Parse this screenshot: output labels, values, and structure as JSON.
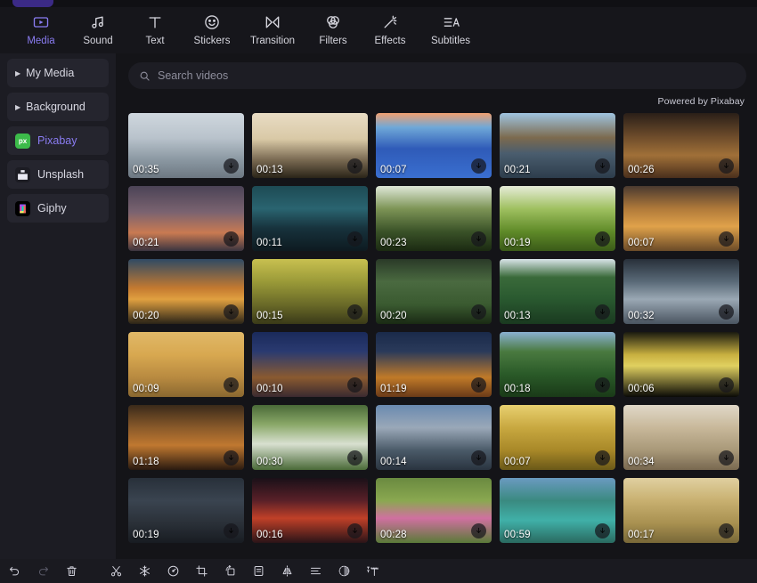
{
  "app": {
    "accent": "#8a7cf2",
    "panel_bg": "#141418",
    "sidebar_bg": "#1c1c23"
  },
  "topbar": {
    "tabs": [
      {
        "label": "Media",
        "icon": "media-play-icon",
        "active": true
      },
      {
        "label": "Sound",
        "icon": "music-note-icon",
        "active": false
      },
      {
        "label": "Text",
        "icon": "text-t-icon",
        "active": false
      },
      {
        "label": "Stickers",
        "icon": "smiley-icon",
        "active": false
      },
      {
        "label": "Transition",
        "icon": "transition-icon",
        "active": false
      },
      {
        "label": "Filters",
        "icon": "filters-icon",
        "active": false
      },
      {
        "label": "Effects",
        "icon": "magic-wand-icon",
        "active": false
      },
      {
        "label": "Subtitles",
        "icon": "subtitles-icon",
        "active": false
      }
    ]
  },
  "sidebar": {
    "items": [
      {
        "label": "My Media",
        "type": "expandable",
        "icon": "chevron-right-icon",
        "active": false
      },
      {
        "label": "Background",
        "type": "expandable",
        "icon": "chevron-right-icon",
        "active": false
      },
      {
        "label": "Pixabay",
        "type": "source",
        "icon": "pixabay-icon",
        "active": true
      },
      {
        "label": "Unsplash",
        "type": "source",
        "icon": "unsplash-icon",
        "active": false
      },
      {
        "label": "Giphy",
        "type": "source",
        "icon": "giphy-icon",
        "active": false
      }
    ]
  },
  "search": {
    "placeholder": "Search videos",
    "value": "",
    "icon": "search-icon"
  },
  "attribution": {
    "text": "Powered by Pixabay"
  },
  "media_grid": {
    "download_icon": "download-arrow-icon",
    "items": [
      {
        "duration": "00:35",
        "scene": "snowy-railway-track"
      },
      {
        "duration": "00:13",
        "scene": "open-book-on-beach"
      },
      {
        "duration": "00:07",
        "scene": "blue-flowers-by-shore"
      },
      {
        "duration": "00:21",
        "scene": "mountain-lake-reflection"
      },
      {
        "duration": "00:26",
        "scene": "christmas-living-room"
      },
      {
        "duration": "00:21",
        "scene": "sunset-over-clouds"
      },
      {
        "duration": "00:11",
        "scene": "milky-way-over-ridge"
      },
      {
        "duration": "00:23",
        "scene": "sunbeams-in-forest"
      },
      {
        "duration": "00:19",
        "scene": "green-grass-closeup"
      },
      {
        "duration": "00:07",
        "scene": "golden-cloudy-sunset"
      },
      {
        "duration": "00:20",
        "scene": "birds-at-sunset-sea"
      },
      {
        "duration": "00:15",
        "scene": "autumn-tree-path"
      },
      {
        "duration": "00:20",
        "scene": "waterfall-in-valley"
      },
      {
        "duration": "00:13",
        "scene": "forest-lake-mirror"
      },
      {
        "duration": "00:32",
        "scene": "rocky-sea-waves"
      },
      {
        "duration": "00:09",
        "scene": "golden-sea-ripples"
      },
      {
        "duration": "00:10",
        "scene": "snowy-village-street-night"
      },
      {
        "duration": "01:19",
        "scene": "girl-with-lanterns-night"
      },
      {
        "duration": "00:18",
        "scene": "jungle-waterfall"
      },
      {
        "duration": "00:06",
        "scene": "full-moon-silhouette"
      },
      {
        "duration": "01:18",
        "scene": "cat-by-fireplace"
      },
      {
        "duration": "00:30",
        "scene": "cascading-waterfall"
      },
      {
        "duration": "00:14",
        "scene": "storm-clouds-horizon"
      },
      {
        "duration": "00:07",
        "scene": "golden-light-rays"
      },
      {
        "duration": "00:34",
        "scene": "misty-forest-trees"
      },
      {
        "duration": "00:19",
        "scene": "rainy-cabin-night"
      },
      {
        "duration": "00:16",
        "scene": "red-volcano-landscape"
      },
      {
        "duration": "00:28",
        "scene": "pink-water-lilies"
      },
      {
        "duration": "00:59",
        "scene": "turquoise-river-falls"
      },
      {
        "duration": "00:17",
        "scene": "wheat-field-closeup"
      }
    ]
  },
  "bottombar": {
    "buttons": [
      {
        "name": "undo",
        "icon": "undo-arrow-icon",
        "enabled": true
      },
      {
        "name": "redo",
        "icon": "redo-arrow-icon",
        "enabled": false
      },
      {
        "name": "delete",
        "icon": "trash-icon",
        "enabled": true
      },
      {
        "name": "split",
        "icon": "scissors-icon",
        "enabled": true
      },
      {
        "name": "freeze",
        "icon": "snowflake-icon",
        "enabled": true
      },
      {
        "name": "speed",
        "icon": "speedometer-icon",
        "enabled": true
      },
      {
        "name": "crop",
        "icon": "crop-icon",
        "enabled": true
      },
      {
        "name": "rotate",
        "icon": "rotate-icon",
        "enabled": true
      },
      {
        "name": "caption",
        "icon": "caption-box-icon",
        "enabled": true
      },
      {
        "name": "mirror",
        "icon": "mirror-flip-icon",
        "enabled": true
      },
      {
        "name": "align",
        "icon": "align-icon",
        "enabled": true
      },
      {
        "name": "mask",
        "icon": "mask-icon",
        "enabled": true
      },
      {
        "name": "add-text",
        "icon": "add-text-icon",
        "enabled": true
      }
    ]
  }
}
